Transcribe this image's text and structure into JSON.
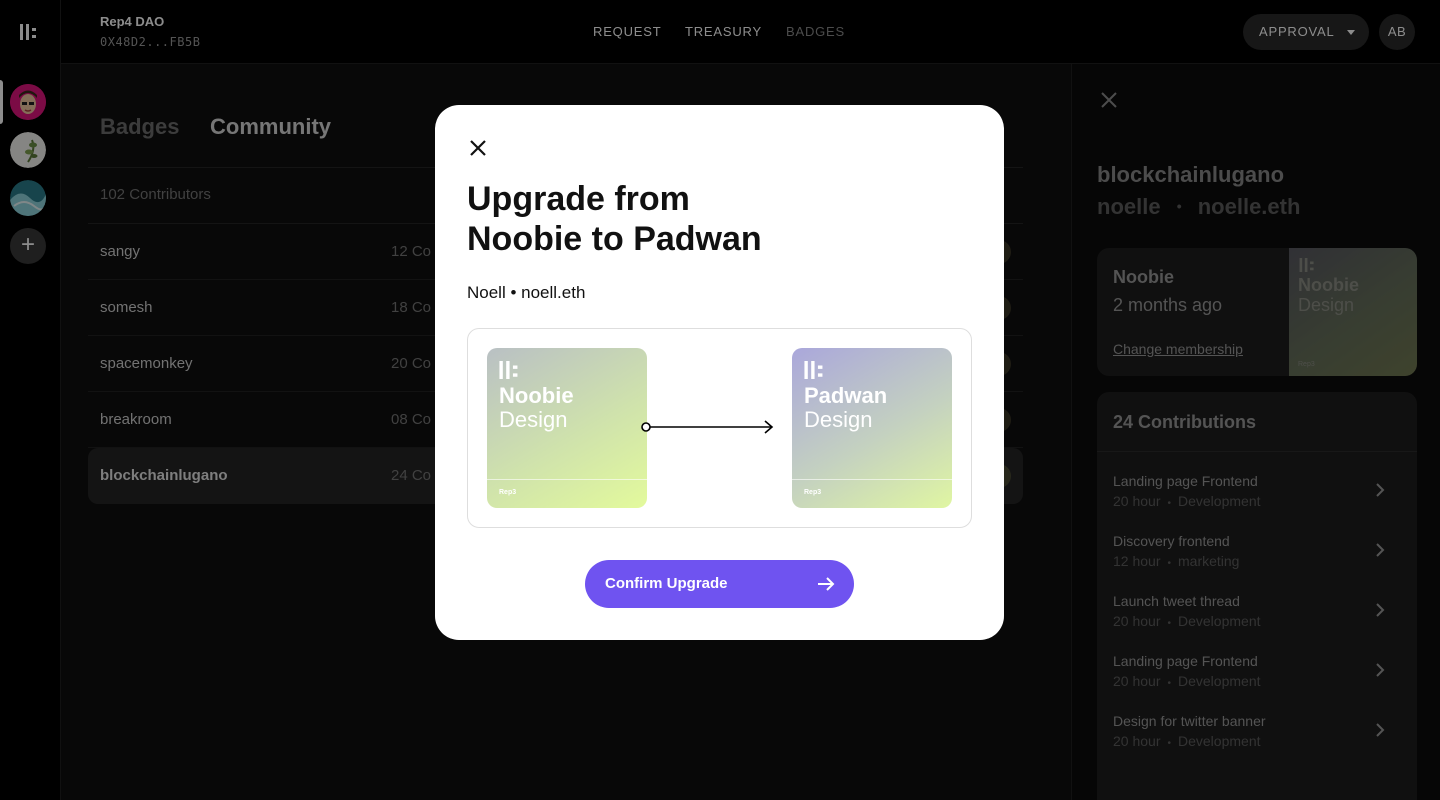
{
  "header": {
    "dao_name": "Rep4 DAO",
    "dao_address": "0X48D2...FB5B",
    "nav": {
      "request": "REQUEST",
      "treasury": "TREASURY",
      "badges": "BADGES"
    },
    "approval_label": "APPROVAL",
    "user_initials": "AB"
  },
  "sidebar": {
    "icons": [
      "rep3-logo-icon",
      "dao-avatar-1",
      "dao-avatar-2",
      "dao-avatar-3",
      "plus-icon"
    ],
    "add_label": "+"
  },
  "main": {
    "tabs": {
      "badges": "Badges",
      "community": "Community"
    },
    "contributors_count": "102 Contributors",
    "rows": [
      {
        "name": "sangy",
        "count": "12 Co"
      },
      {
        "name": "somesh",
        "count": "18 Co"
      },
      {
        "name": "spacemonkey",
        "count": "20 Co"
      },
      {
        "name": "breakroom",
        "count": "08 Co"
      },
      {
        "name": "blockchainlugano",
        "count": "24 Co"
      }
    ]
  },
  "panel": {
    "username": "blockchainlugano",
    "alias": "noelle",
    "ens": "noelle.eth",
    "separator": "•",
    "membership": {
      "level": "Noobie",
      "since": "2 months ago",
      "change_label": "Change membership",
      "badge_title": "Noobie",
      "badge_sub": "Design",
      "badge_brand": "Rep3"
    },
    "contributions_title": "24 Contributions",
    "contributions": [
      {
        "title": "Landing page Frontend",
        "duration": "20 hour",
        "sep": "•",
        "category": "Development"
      },
      {
        "title": "Discovery frontend",
        "duration": "12 hour",
        "sep": "•",
        "category": "marketing"
      },
      {
        "title": "Launch tweet thread",
        "duration": "20 hour",
        "sep": "•",
        "category": "Development"
      },
      {
        "title": "Landing page Frontend",
        "duration": "20 hour",
        "sep": "•",
        "category": "Development"
      },
      {
        "title": "Design for twitter banner",
        "duration": "20 hour",
        "sep": "•",
        "category": "Development"
      }
    ]
  },
  "modal": {
    "title_line1": "Upgrade from",
    "title_line2": "Noobie to Padwan",
    "subtitle": "Noell • noell.eth",
    "from_badge": {
      "title": "Noobie",
      "subtitle": "Design",
      "brand": "Rep3"
    },
    "to_badge": {
      "title": "Padwan",
      "subtitle": "Design",
      "brand": "Rep3"
    },
    "confirm_label": "Confirm Upgrade"
  },
  "colors": {
    "accent": "#6f53f0",
    "background": "#000000",
    "modal_bg": "#ffffff"
  }
}
